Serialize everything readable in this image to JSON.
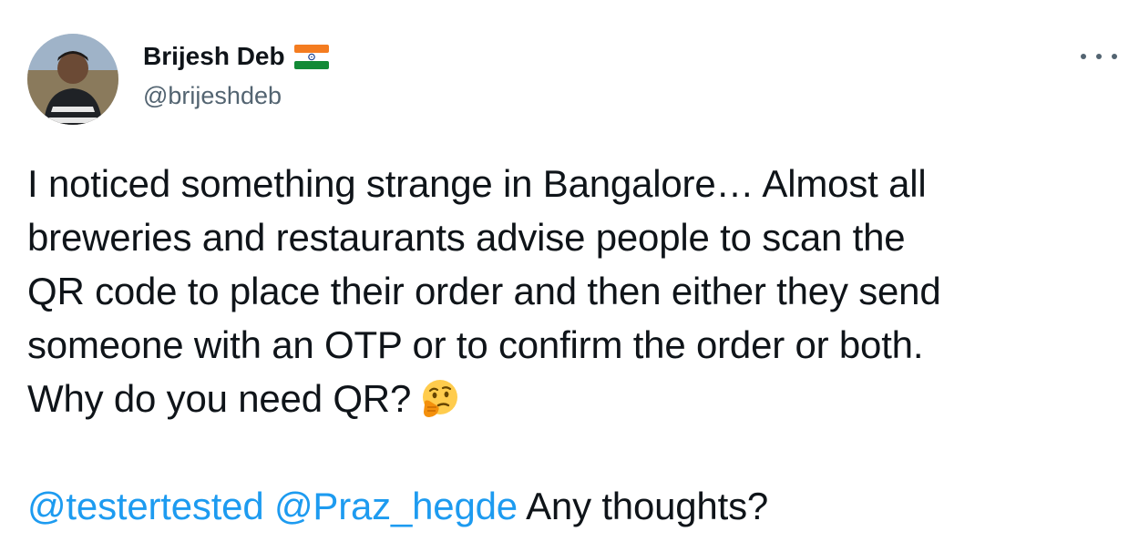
{
  "author": {
    "display_name": "Brijesh Deb",
    "handle": "@brijeshdeb",
    "flag_icon": "india-flag-icon",
    "avatar_icon": "profile-photo"
  },
  "more_icon": "more-options-icon",
  "tweet": {
    "lines": [
      "I noticed something strange in Bangalore… Almost all",
      "breweries and restaurants advise people to scan the",
      "QR code to place their order and then either they send",
      "someone with an OTP or to confirm the order or both.",
      "Why do you need QR?"
    ],
    "emoji": "thinking-face-emoji",
    "mentions": [
      "@testertested",
      "@Praz_hegde"
    ],
    "reply_text": "Any thoughts?"
  },
  "colors": {
    "text": "#0f1419",
    "secondary": "#536471",
    "link": "#1d9bf0"
  }
}
